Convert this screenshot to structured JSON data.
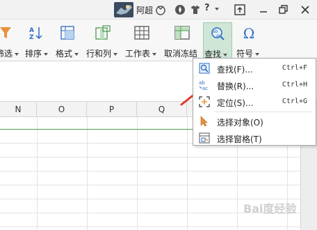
{
  "titlebar": {
    "user_name": "阿超",
    "help_label": "?"
  },
  "ribbon": {
    "items": [
      {
        "label": "筛选"
      },
      {
        "label": "排序"
      },
      {
        "label": "格式"
      },
      {
        "label": "行和列"
      },
      {
        "label": "工作表"
      },
      {
        "label": "取消冻结"
      },
      {
        "label": "查找"
      },
      {
        "label": "符号"
      }
    ]
  },
  "grid": {
    "columns": [
      "N",
      "O",
      "P",
      "Q"
    ]
  },
  "menu": {
    "items": [
      {
        "label": "查找(F)...",
        "shortcut": "Ctrl+F",
        "icon": "find-icon"
      },
      {
        "label": "替换(R)...",
        "shortcut": "Ctrl+H",
        "icon": "replace-icon"
      },
      {
        "label": "定位(S)...",
        "shortcut": "Ctrl+G",
        "icon": "goto-icon"
      },
      {
        "label": "选择对象(O)",
        "shortcut": "",
        "icon": "cursor-icon"
      },
      {
        "label": "选择窗格(T)",
        "shortcut": "",
        "icon": "pane-icon"
      }
    ]
  },
  "colors": {
    "accent_green": "#4a9a4e",
    "ribbon_active": "#cfe6d6",
    "arrow_red": "#e03a2f",
    "icon_blue": "#2b6cc4"
  },
  "watermark": "Bai度经验"
}
